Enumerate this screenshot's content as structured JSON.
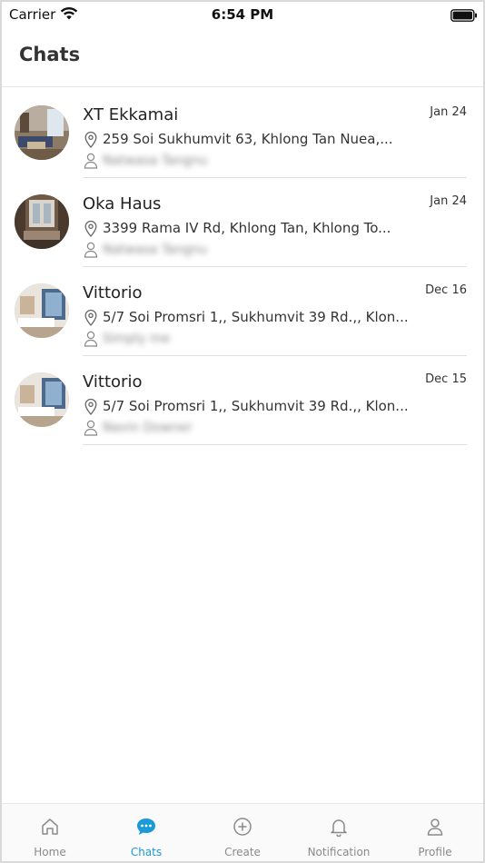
{
  "status_bar": {
    "carrier": "Carrier",
    "time": "6:54 PM"
  },
  "header": {
    "title": "Chats"
  },
  "chats": [
    {
      "name": "XT Ekkamai",
      "date": "Jan 24",
      "address": "259 Soi Sukhumvit 63, Khlong Tan Nuea,...",
      "username": "Natwasa Tangnu"
    },
    {
      "name": "Oka Haus",
      "date": "Jan 24",
      "address": "3399 Rama IV Rd, Khlong Tan, Khlong To...",
      "username": "Natwasa Tangnu"
    },
    {
      "name": "Vittorio",
      "date": "Dec 16",
      "address": "5/7 Soi Promsri 1,, Sukhumvit 39 Rd.,, Klon...",
      "username": "Simply me"
    },
    {
      "name": "Vittorio",
      "date": "Dec 15",
      "address": "5/7 Soi Promsri 1,, Sukhumvit 39 Rd.,, Klon...",
      "username": "Navin Downer"
    }
  ],
  "tabs": [
    {
      "label": "Home",
      "icon": "home-icon"
    },
    {
      "label": "Chats",
      "icon": "chat-bubble-icon",
      "active": true
    },
    {
      "label": "Create",
      "icon": "plus-circle-icon"
    },
    {
      "label": "Notification",
      "icon": "bell-icon"
    },
    {
      "label": "Profile",
      "icon": "person-icon"
    }
  ],
  "colors": {
    "accent": "#1a9ad6",
    "tab_inactive": "#8a8a8a",
    "divider": "#e0e0e0"
  }
}
